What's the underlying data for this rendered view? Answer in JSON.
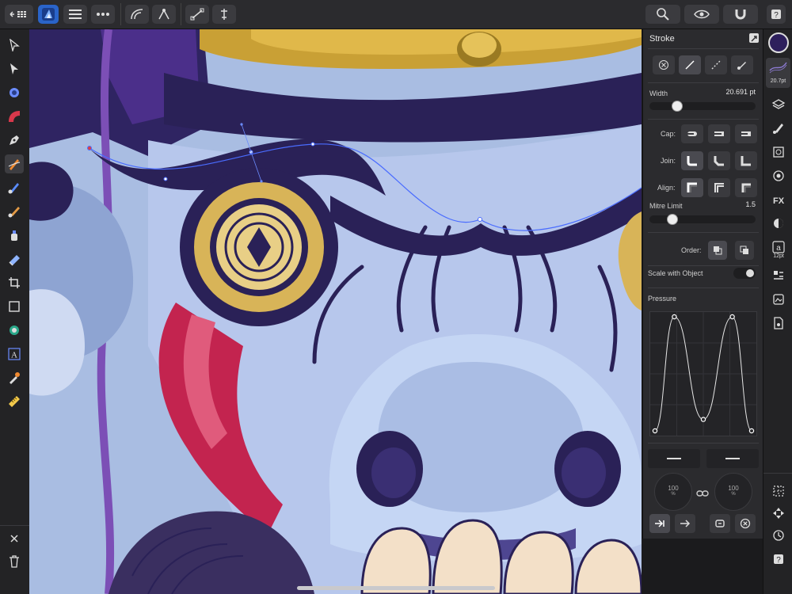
{
  "app": {
    "accent": "#2f8cf5"
  },
  "topbar": {
    "left_icons": [
      "back-grid-icon",
      "designer-logo-icon",
      "menu-icon",
      "more-icon",
      "node-tool-icon",
      "transform-icon",
      "snapping-icon",
      "align-icon"
    ],
    "right_icons": [
      "zoom-icon",
      "view-mode-icon",
      "magnet-icon",
      "help-icon"
    ]
  },
  "left_tools": [
    "move-tool-icon",
    "node-tool-icon",
    "corner-tool-icon",
    "fill-tool-icon",
    "pen-tool-icon",
    "pencil-tool-icon",
    "vector-brush-icon",
    "paint-brush-icon",
    "spray-icon",
    "eraser-icon",
    "crop-icon",
    "rectangle-tool-icon",
    "shape-tool-icon",
    "text-tool-icon",
    "color-picker-icon",
    "ruler-icon"
  ],
  "left_bottom": [
    "close-icon",
    "trash-icon"
  ],
  "right_strip": {
    "color_swatch": "#2d1f5c",
    "brush_size": "20.7pt",
    "text_size": "12pt"
  },
  "stroke": {
    "title": "Stroke",
    "width_label": "Width",
    "width_value": "20.691 pt",
    "width_fraction": 0.23,
    "cap_label": "Cap:",
    "join_label": "Join:",
    "align_label": "Align:",
    "mitre_label": "Mitre Limit",
    "mitre_value": "1.5",
    "mitre_fraction": 0.18,
    "order_label": "Order:",
    "scale_label": "Scale with Object",
    "pressure_label": "Pressure",
    "pressure_points": [
      [
        0,
        0
      ],
      [
        0.2,
        1
      ],
      [
        0.5,
        0.1
      ],
      [
        0.8,
        1
      ],
      [
        1,
        0
      ]
    ],
    "dial_left": "100",
    "dial_left_unit": "%",
    "dial_right": "100",
    "dial_right_unit": "%"
  }
}
